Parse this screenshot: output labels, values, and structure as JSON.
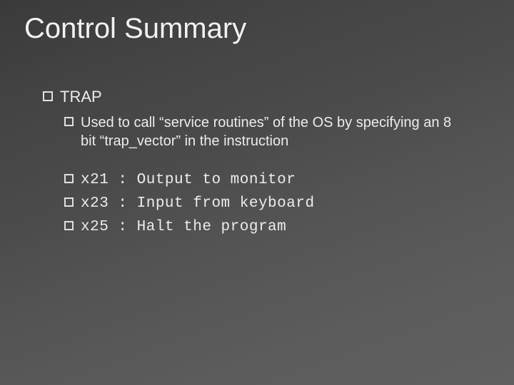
{
  "title": "Control Summary",
  "bullet_l1": "TRAP",
  "bullet_l2": "Used to call “service routines” of the OS by specifying an 8 bit “trap_vector” in the instruction",
  "traps": [
    {
      "code": "x21",
      "desc": "Output to monitor"
    },
    {
      "code": "x23",
      "desc": "Input from keyboard"
    },
    {
      "code": "x25",
      "desc": "Halt the program"
    }
  ]
}
